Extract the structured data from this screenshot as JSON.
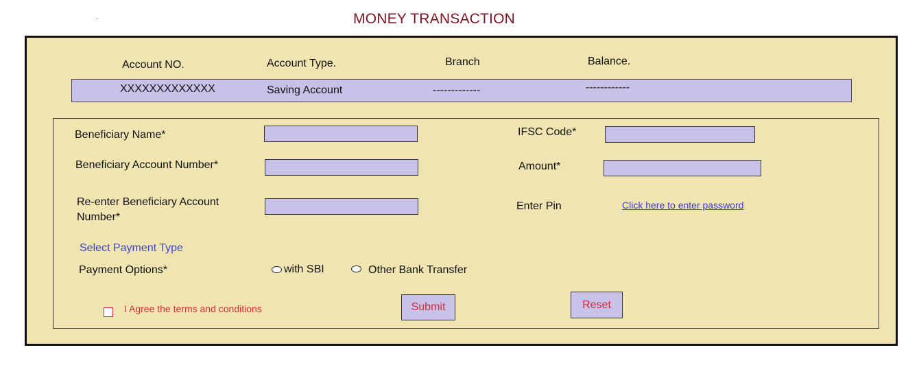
{
  "page": {
    "title": "MONEY TRANSACTION",
    "dot": "."
  },
  "account_header": {
    "col_account_no": "Account NO.",
    "col_account_type": "Account Type.",
    "col_branch": "Branch",
    "col_balance": "Balance."
  },
  "account_row": {
    "account_no": "XXXXXXXXXXXXX",
    "account_type": "Saving Account",
    "branch": "-------------",
    "balance": "------------"
  },
  "form": {
    "beneficiary_name_label": "Beneficiary Name*",
    "beneficiary_account_label": "Beneficiary Account Number*",
    "reenter_account_label_1": "Re-enter Beneficiary Account",
    "reenter_account_label_2": "Number*",
    "ifsc_label": "IFSC Code*",
    "amount_label": "Amount*",
    "pin_label": "Enter Pin",
    "pin_link": "Click here to enter password",
    "payment_type_heading": "Select Payment Type",
    "payment_options_label": "Payment Options*",
    "option_sbi": "with SBI",
    "option_other": "Other Bank Transfer",
    "agree_text": "I Agree the terms and conditions",
    "submit_label": "Submit",
    "reset_label": "Reset"
  }
}
